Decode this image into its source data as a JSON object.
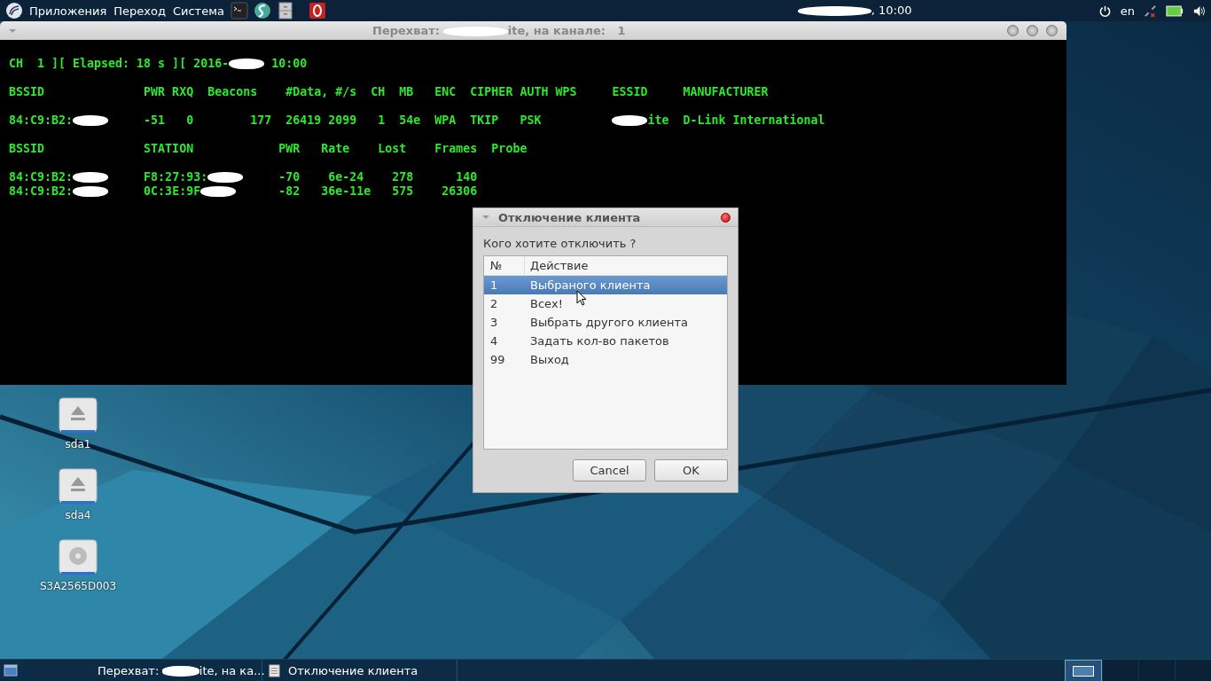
{
  "top_panel": {
    "menus": [
      "Приложения",
      "Переход",
      "Система"
    ],
    "clock": [
      {
        "kind": "redaction"
      },
      {
        "kind": "text",
        "text": ", 10:00"
      }
    ],
    "keyboard_layout": "en"
  },
  "terminal_window": {
    "title": [
      {
        "kind": "text",
        "text": "Перехват: "
      },
      {
        "kind": "redaction"
      },
      {
        "kind": "text",
        "text": "ite, на канале:   1"
      }
    ],
    "output": [
      [
        [
          {
            "kind": "text",
            "text": "CH  1 ][ Elapsed: 18 s ][ 2016-"
          },
          {
            "kind": "redaction"
          },
          {
            "kind": "text",
            "text": " 10:00"
          }
        ]
      ],
      [
        [
          {
            "kind": "text",
            "text": "BSSID              PWR RXQ  Beacons    #Data, #/s  CH  MB   ENC  CIPHER AUTH WPS     ESSID     MANUFACTURER"
          }
        ]
      ],
      [
        [
          {
            "kind": "text",
            "text": "84:C9:B2:"
          },
          {
            "kind": "redaction"
          },
          {
            "kind": "text",
            "text": "     -51   0        177  26419 2099   1  54e  WPA  TKIP   PSK          "
          },
          {
            "kind": "redaction"
          },
          {
            "kind": "text",
            "text": "ite  D-Link International"
          }
        ]
      ],
      [
        [
          {
            "kind": "text",
            "text": "BSSID              STATION            PWR   Rate    Lost    Frames  Probe"
          }
        ]
      ],
      [
        [
          {
            "kind": "text",
            "text": "84:C9:B2:"
          },
          {
            "kind": "redaction"
          },
          {
            "kind": "text",
            "text": "     F8:27:93:"
          },
          {
            "kind": "redaction"
          },
          {
            "kind": "text",
            "text": "     -70    6e-24    278      140"
          }
        ],
        [
          {
            "kind": "text",
            "text": "84:C9:B2:"
          },
          {
            "kind": "redaction"
          },
          {
            "kind": "text",
            "text": "     0C:3E:9F"
          },
          {
            "kind": "redaction"
          },
          {
            "kind": "text",
            "text": "      -82   36e-11e   575    26306"
          }
        ]
      ]
    ]
  },
  "desktop_icons": [
    {
      "kind": "drive",
      "label": "sda1"
    },
    {
      "kind": "drive",
      "label": "sda4"
    },
    {
      "kind": "disk",
      "label": "S3A2565D003"
    }
  ],
  "dialog": {
    "title": "Отключение клиента",
    "prompt": "Кого хотите отключить ?",
    "columns": [
      "№",
      "Действие"
    ],
    "rows": [
      {
        "number": "1",
        "action": "Выбраного клиента",
        "selected": true
      },
      {
        "number": "2",
        "action": "Всех!",
        "selected": false
      },
      {
        "number": "3",
        "action": "Выбрать другого клиента",
        "selected": false
      },
      {
        "number": "4",
        "action": "Задать кол-во пакетов",
        "selected": false
      },
      {
        "number": "99",
        "action": "Выход",
        "selected": false
      }
    ],
    "buttons": [
      "Cancel",
      "OK"
    ]
  },
  "taskbar": {
    "tasks": [
      {
        "kind": "terminal",
        "label": [
          {
            "kind": "text",
            "text": "Перехват: "
          },
          {
            "kind": "redaction"
          },
          {
            "kind": "text",
            "text": "ite, на ка..."
          }
        ]
      },
      {
        "kind": "dialog",
        "label": [
          {
            "kind": "text",
            "text": "Отключение клиента"
          }
        ]
      }
    ],
    "workspaces": [
      {
        "selected": true
      },
      {
        "selected": false
      },
      {
        "selected": false
      },
      {
        "selected": false
      }
    ]
  }
}
